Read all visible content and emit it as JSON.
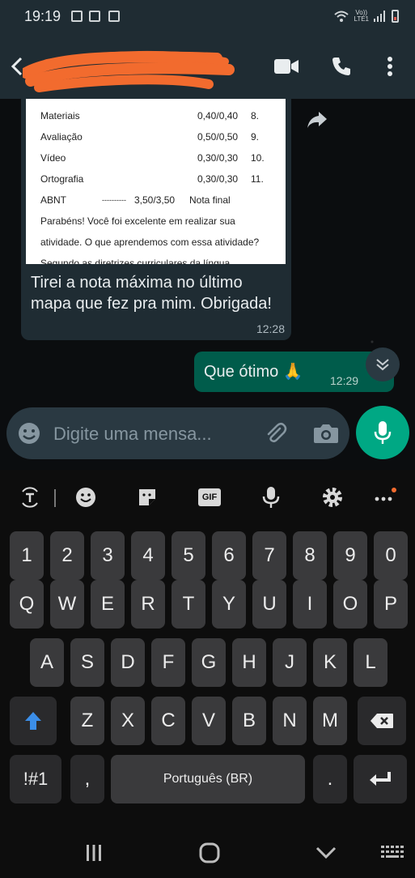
{
  "status_bar": {
    "time": "19:19",
    "network_label_top": "Vo))",
    "network_label_bottom": "LTE1"
  },
  "header": {
    "contact_name": "",
    "icons": [
      "back-arrow-icon",
      "video-call-icon",
      "phone-icon",
      "more-options-icon"
    ]
  },
  "messages": {
    "incoming": {
      "image_rows": [
        {
          "label": "Materiais",
          "score": "0,40/0,40",
          "num": "8."
        },
        {
          "label": "Avaliação",
          "score": "0,50/0,50",
          "num": "9."
        },
        {
          "label": "Vídeo",
          "score": "0,30/0,30",
          "num": "10."
        },
        {
          "label": "Ortografia",
          "score": "0,30/0,30",
          "num": "11."
        }
      ],
      "image_abnt_label": "ABNT",
      "image_abnt_dashes": "----------",
      "image_abnt_score": "3,50/3,50",
      "image_final_label": "Nota final",
      "image_line_1": "Parabéns! Você foi excelente em realizar sua",
      "image_line_2": "atividade.  O que aprendemos com essa atividade?",
      "image_line_3": "Segundo as diretrizes curriculares da língua",
      "text": "Tirei a nota máxima no último mapa que fez pra mim. Obrigada!",
      "time": "12:28"
    },
    "outgoing": {
      "text": "Que ótimo 🙏",
      "time": "12:29"
    }
  },
  "composer": {
    "placeholder": "Digite uma mensa..."
  },
  "keyboard": {
    "row_numbers": [
      "1",
      "2",
      "3",
      "4",
      "5",
      "6",
      "7",
      "8",
      "9",
      "0"
    ],
    "row_1": [
      "Q",
      "W",
      "E",
      "R",
      "T",
      "Y",
      "U",
      "I",
      "O",
      "P"
    ],
    "row_2": [
      "A",
      "S",
      "D",
      "F",
      "G",
      "H",
      "J",
      "K",
      "L"
    ],
    "row_3": [
      "Z",
      "X",
      "C",
      "V",
      "B",
      "N",
      "M"
    ],
    "symbols_key": "!#1",
    "comma_key": ",",
    "space_key": "Português (BR)",
    "period_key": ".",
    "gif_label": "GIF"
  },
  "colors": {
    "header_bg": "#1f2c33",
    "outgoing_bubble": "#005c4b",
    "accent": "#00a884",
    "redaction": "#f26b2e"
  }
}
